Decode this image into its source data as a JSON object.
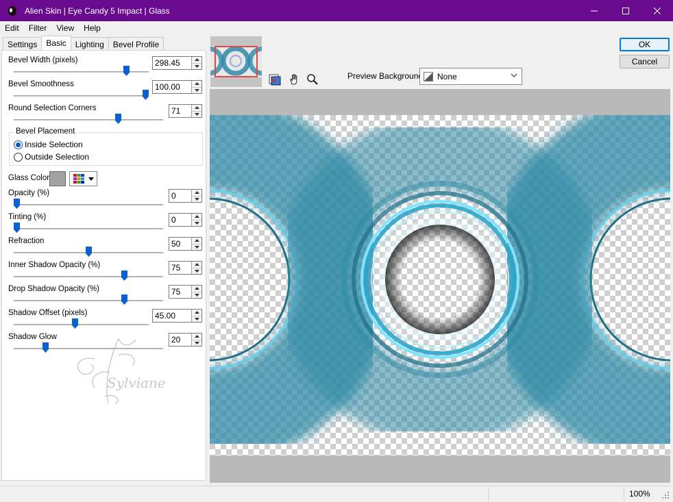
{
  "window": {
    "title": "Alien Skin | Eye Candy 5 Impact | Glass",
    "title_color": "#6a0b8f"
  },
  "menu": [
    "Edit",
    "Filter",
    "View",
    "Help"
  ],
  "tabs": [
    {
      "label": "Settings",
      "active": false
    },
    {
      "label": "Basic",
      "active": true
    },
    {
      "label": "Lighting",
      "active": false
    },
    {
      "label": "Bevel Profile",
      "active": false
    }
  ],
  "params": {
    "bevel_width": {
      "label": "Bevel Width (pixels)",
      "value": "298.45",
      "slider_fraction": 0.85
    },
    "bevel_smoothness": {
      "label": "Bevel Smoothness",
      "value": "100.00",
      "slider_fraction": 1.0
    },
    "round_corners": {
      "label": "Round Selection Corners",
      "value": "71",
      "slider_fraction": 0.71
    },
    "opacity": {
      "label": "Opacity (%)",
      "value": "0",
      "slider_fraction": 0.0
    },
    "tinting": {
      "label": "Tinting (%)",
      "value": "0",
      "slider_fraction": 0.0
    },
    "refraction": {
      "label": "Refraction",
      "value": "50",
      "slider_fraction": 0.5
    },
    "inner_shadow": {
      "label": "Inner Shadow Opacity (%)",
      "value": "75",
      "slider_fraction": 0.75
    },
    "drop_shadow": {
      "label": "Drop Shadow Opacity (%)",
      "value": "75",
      "slider_fraction": 0.75
    },
    "shadow_offset": {
      "label": "Shadow Offset (pixels)",
      "value": "45.00",
      "slider_fraction": 0.45
    },
    "shadow_glow": {
      "label": "Shadow Glow",
      "value": "20",
      "slider_fraction": 0.2
    }
  },
  "bevel_placement": {
    "title": "Bevel Placement",
    "options": [
      "Inside Selection",
      "Outside Selection"
    ],
    "selected": "Inside Selection"
  },
  "glass_color": {
    "label": "Glass Color",
    "color": "#a3a3a3"
  },
  "watermark_text": "Sylviane",
  "preview": {
    "bg_label": "Preview Background:",
    "bg_value": "None",
    "glass_color": "#2f8aa6"
  },
  "buttons": {
    "ok": "OK",
    "cancel": "Cancel"
  },
  "status": {
    "zoom": "100%"
  }
}
